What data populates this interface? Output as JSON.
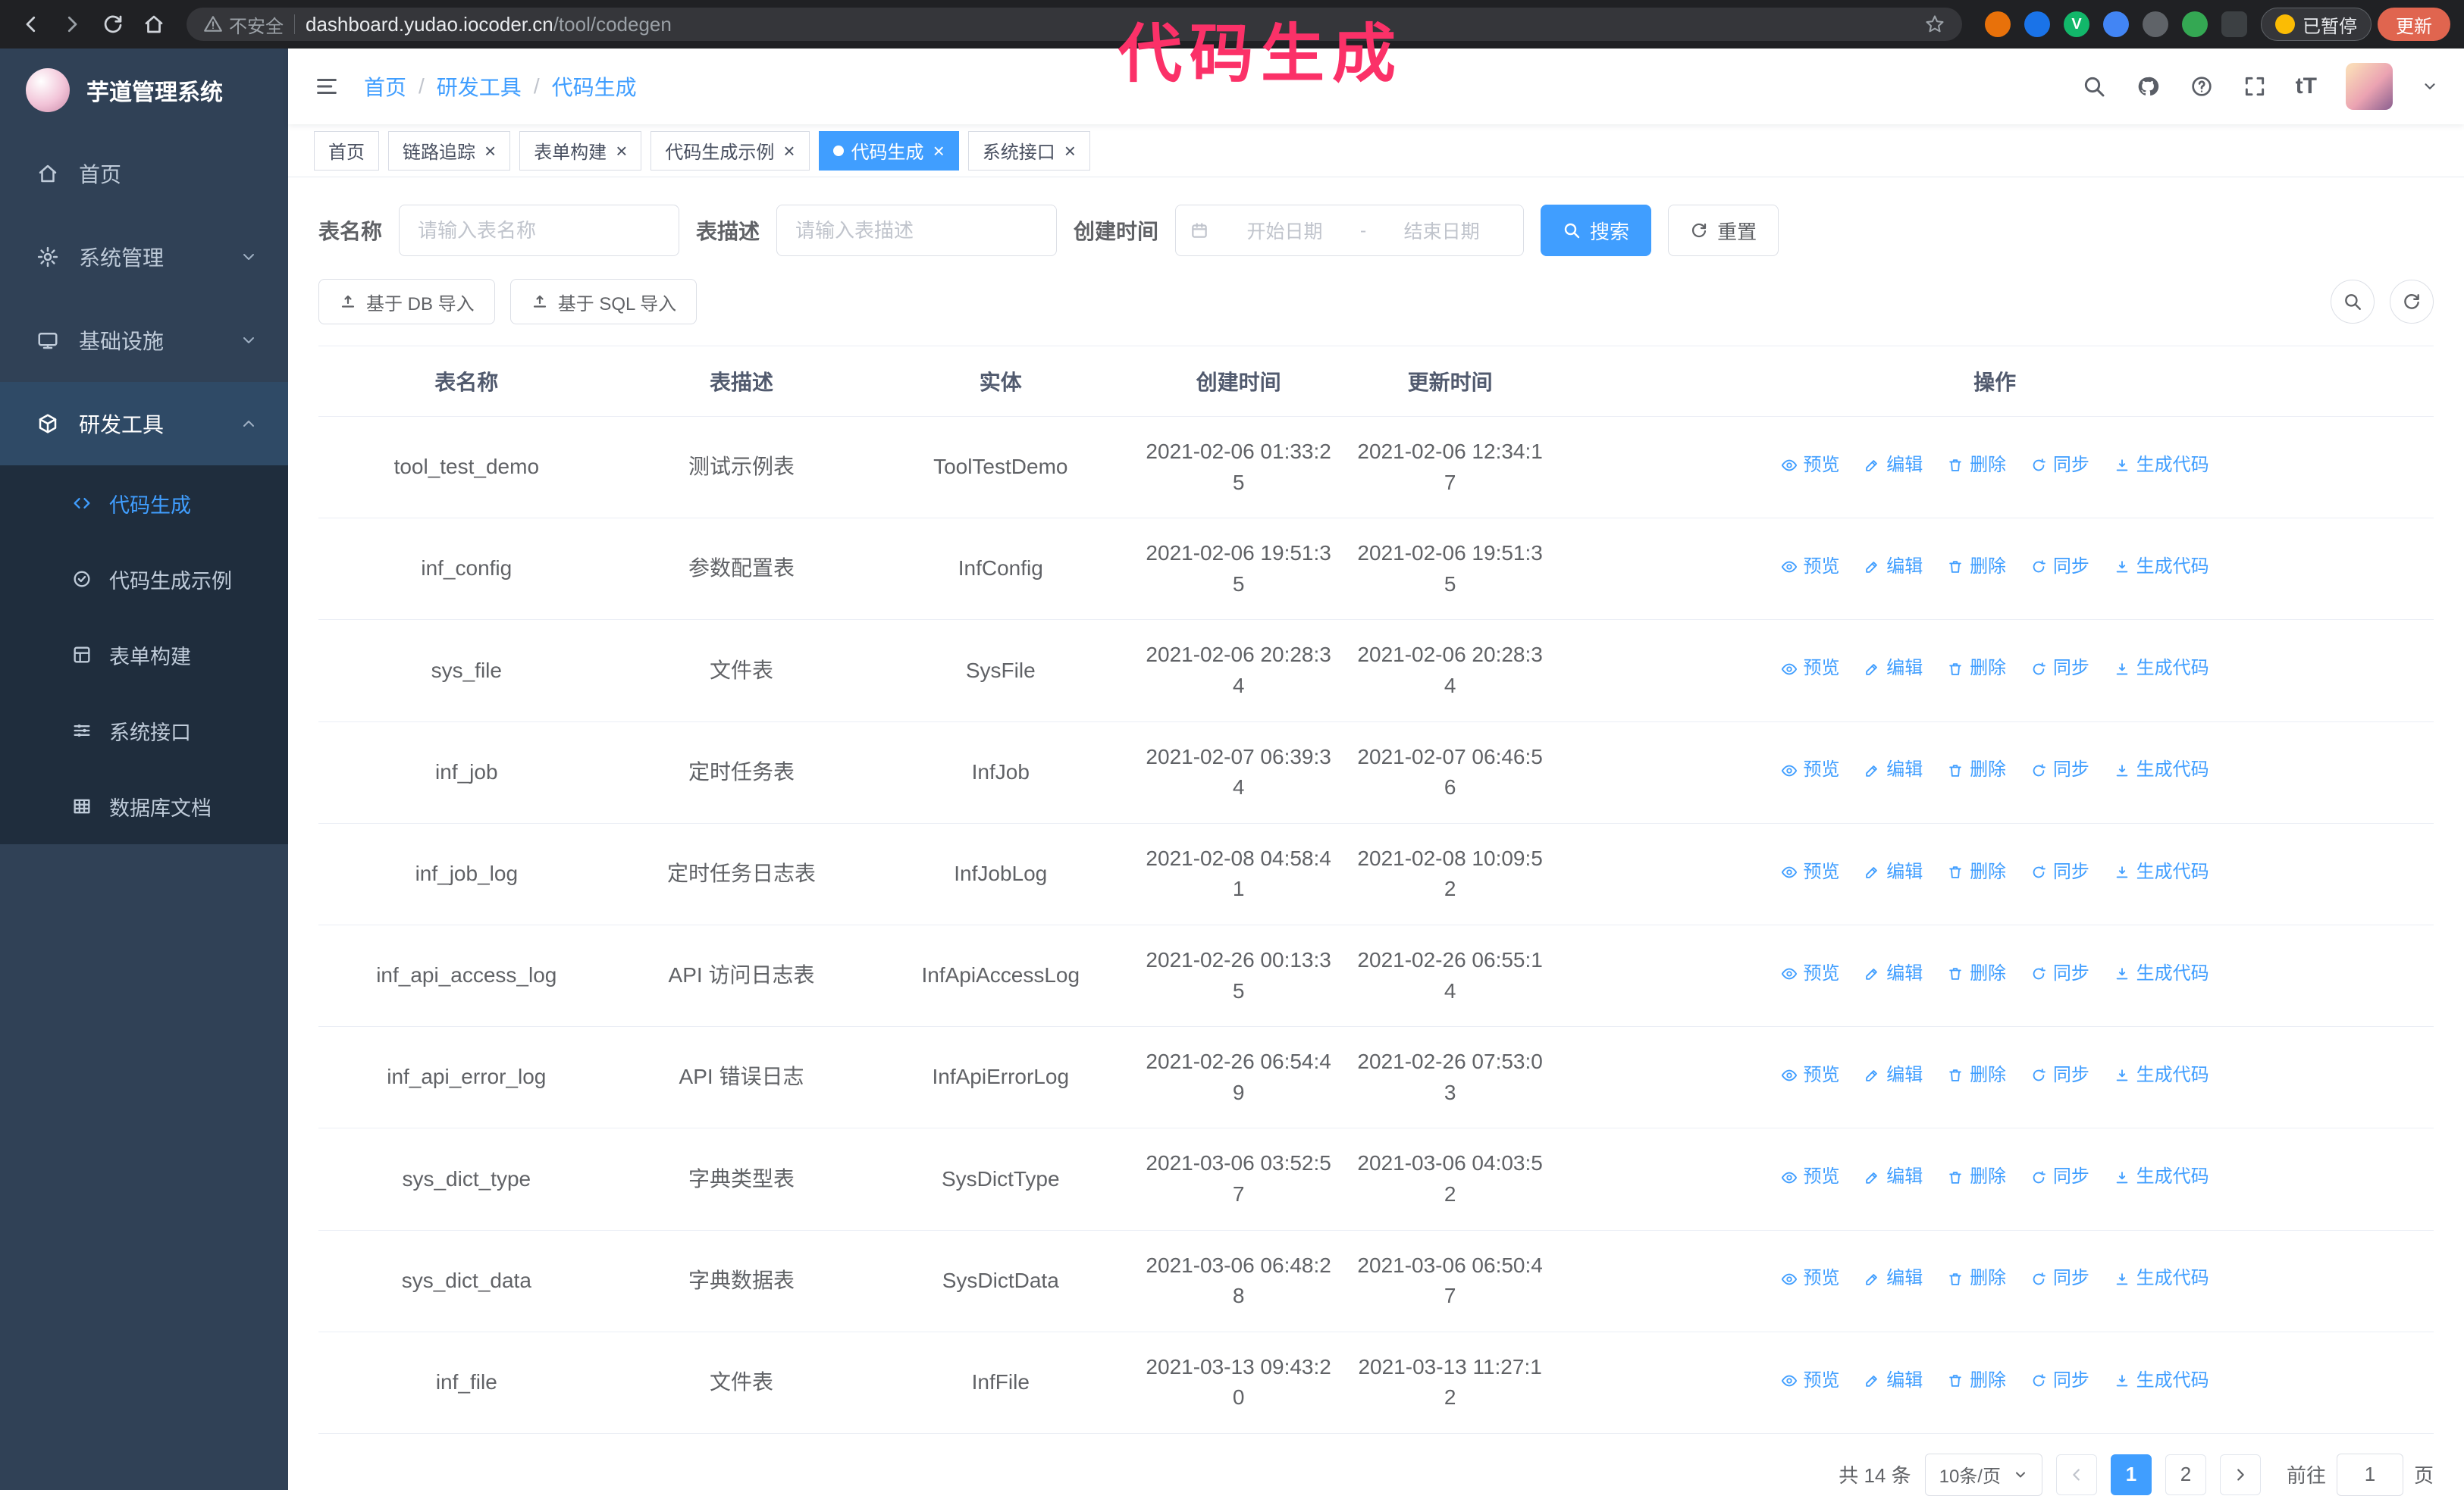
{
  "annotation": "代码生成",
  "browser": {
    "security_warning": "不安全",
    "url_host": "dashboard.yudao.iocoder.cn",
    "url_path": "/tool/codegen",
    "paused_badge": "已暂停",
    "update_button": "更新",
    "extension_v_label": "V"
  },
  "sidebar": {
    "logo_title": "芋道管理系统",
    "items": [
      {
        "label": "首页"
      },
      {
        "label": "系统管理"
      },
      {
        "label": "基础设施"
      },
      {
        "label": "研发工具"
      }
    ],
    "subitems": [
      {
        "label": "代码生成"
      },
      {
        "label": "代码生成示例"
      },
      {
        "label": "表单构建"
      },
      {
        "label": "系统接口"
      },
      {
        "label": "数据库文档"
      }
    ]
  },
  "header": {
    "breadcrumb": [
      "首页",
      "研发工具",
      "代码生成"
    ],
    "font_size_label": "tT"
  },
  "tabs": [
    {
      "label": "首页",
      "closable": false,
      "active": false
    },
    {
      "label": "链路追踪",
      "closable": true,
      "active": false
    },
    {
      "label": "表单构建",
      "closable": true,
      "active": false
    },
    {
      "label": "代码生成示例",
      "closable": true,
      "active": false
    },
    {
      "label": "代码生成",
      "closable": true,
      "active": true
    },
    {
      "label": "系统接口",
      "closable": true,
      "active": false
    }
  ],
  "filters": {
    "table_name_label": "表名称",
    "table_name_placeholder": "请输入表名称",
    "table_desc_label": "表描述",
    "table_desc_placeholder": "请输入表描述",
    "create_time_label": "创建时间",
    "date_start_placeholder": "开始日期",
    "date_separator": "-",
    "date_end_placeholder": "结束日期",
    "search_button": "搜索",
    "reset_button": "重置"
  },
  "toolbar": {
    "import_db_button": "基于 DB 导入",
    "import_sql_button": "基于 SQL 导入"
  },
  "table": {
    "columns": [
      "表名称",
      "表描述",
      "实体",
      "创建时间",
      "更新时间",
      "操作"
    ],
    "actions": [
      "预览",
      "编辑",
      "删除",
      "同步",
      "生成代码"
    ],
    "rows": [
      {
        "name": "tool_test_demo",
        "desc": "测试示例表",
        "entity": "ToolTestDemo",
        "created": "2021-02-06 01:33:25",
        "updated": "2021-02-06 12:34:17"
      },
      {
        "name": "inf_config",
        "desc": "参数配置表",
        "entity": "InfConfig",
        "created": "2021-02-06 19:51:35",
        "updated": "2021-02-06 19:51:35"
      },
      {
        "name": "sys_file",
        "desc": "文件表",
        "entity": "SysFile",
        "created": "2021-02-06 20:28:34",
        "updated": "2021-02-06 20:28:34"
      },
      {
        "name": "inf_job",
        "desc": "定时任务表",
        "entity": "InfJob",
        "created": "2021-02-07 06:39:34",
        "updated": "2021-02-07 06:46:56"
      },
      {
        "name": "inf_job_log",
        "desc": "定时任务日志表",
        "entity": "InfJobLog",
        "created": "2021-02-08 04:58:41",
        "updated": "2021-02-08 10:09:52"
      },
      {
        "name": "inf_api_access_log",
        "desc": "API 访问日志表",
        "entity": "InfApiAccessLog",
        "created": "2021-02-26 00:13:35",
        "updated": "2021-02-26 06:55:14"
      },
      {
        "name": "inf_api_error_log",
        "desc": "API 错误日志",
        "entity": "InfApiErrorLog",
        "created": "2021-02-26 06:54:49",
        "updated": "2021-02-26 07:53:03"
      },
      {
        "name": "sys_dict_type",
        "desc": "字典类型表",
        "entity": "SysDictType",
        "created": "2021-03-06 03:52:57",
        "updated": "2021-03-06 04:03:52"
      },
      {
        "name": "sys_dict_data",
        "desc": "字典数据表",
        "entity": "SysDictData",
        "created": "2021-03-06 06:48:28",
        "updated": "2021-03-06 06:50:47"
      },
      {
        "name": "inf_file",
        "desc": "文件表",
        "entity": "InfFile",
        "created": "2021-03-13 09:43:20",
        "updated": "2021-03-13 11:27:12"
      }
    ]
  },
  "pagination": {
    "total": "共 14 条",
    "page_size": "10条/页",
    "page_1": "1",
    "page_2": "2",
    "goto_label": "前往",
    "goto_value": "1",
    "page_unit": "页"
  },
  "colors": {
    "accent": "#409eff",
    "annotation": "#fb3168",
    "sidebar_bg": "#304156",
    "submenu_bg": "#1f2d3d"
  }
}
